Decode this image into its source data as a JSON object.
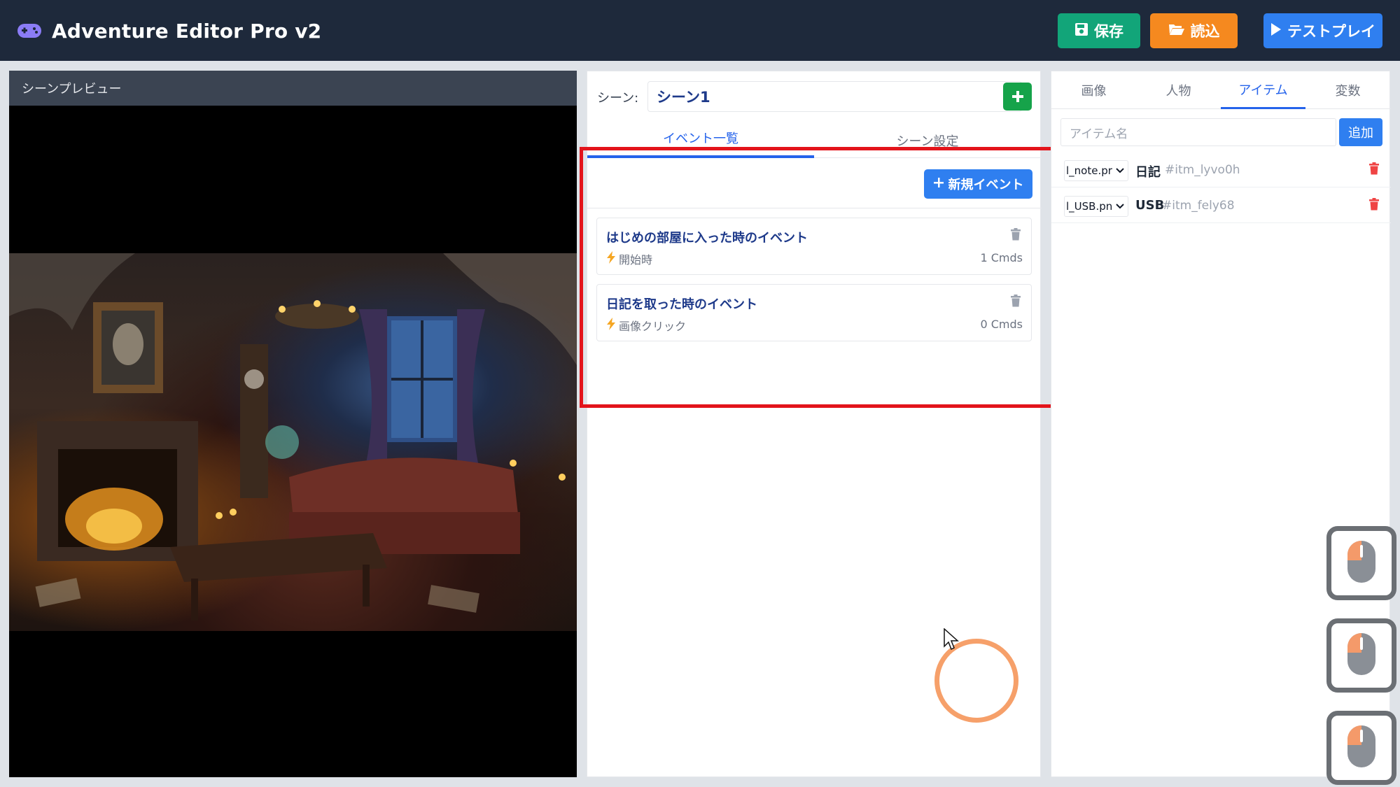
{
  "app": {
    "title": "Adventure Editor Pro v2",
    "brand_icon": "gamepad-icon"
  },
  "toolbar": {
    "save_label": "保存",
    "load_label": "読込",
    "testplay_label": "テストプレイ"
  },
  "preview": {
    "header": "シーンプレビュー"
  },
  "scene": {
    "label": "シーン:",
    "selected": "シーン1",
    "add_icon": "plus-icon"
  },
  "middle_tabs": [
    {
      "label": "イベント一覧",
      "active": true
    },
    {
      "label": "シーン設定",
      "active": false
    }
  ],
  "events_panel": {
    "new_event_label": "新規イベント",
    "events": [
      {
        "title": "はじめの部屋に入った時のイベント",
        "trigger": "開始時",
        "cmds": "1 Cmds"
      },
      {
        "title": "日記を取った時のイベント",
        "trigger": "画像クリック",
        "cmds": "0 Cmds"
      }
    ]
  },
  "right_tabs": [
    {
      "label": "画像",
      "active": false
    },
    {
      "label": "人物",
      "active": false
    },
    {
      "label": "アイテム",
      "active": true
    },
    {
      "label": "変数",
      "active": false
    }
  ],
  "items_panel": {
    "name_placeholder": "アイテム名",
    "add_label": "追加",
    "items": [
      {
        "image": "l_note.pr",
        "name": "日記",
        "id": "#itm_lyvo0h"
      },
      {
        "image": "l_USB.pn",
        "name": "USB",
        "id": "#itm_fely68"
      }
    ]
  },
  "colors": {
    "header_bg": "#1e293b",
    "save": "#12a579",
    "load": "#f5891f",
    "play": "#2f7ff0",
    "accent": "#2563eb",
    "danger": "#ef4444",
    "highlight": "#e3141b"
  }
}
